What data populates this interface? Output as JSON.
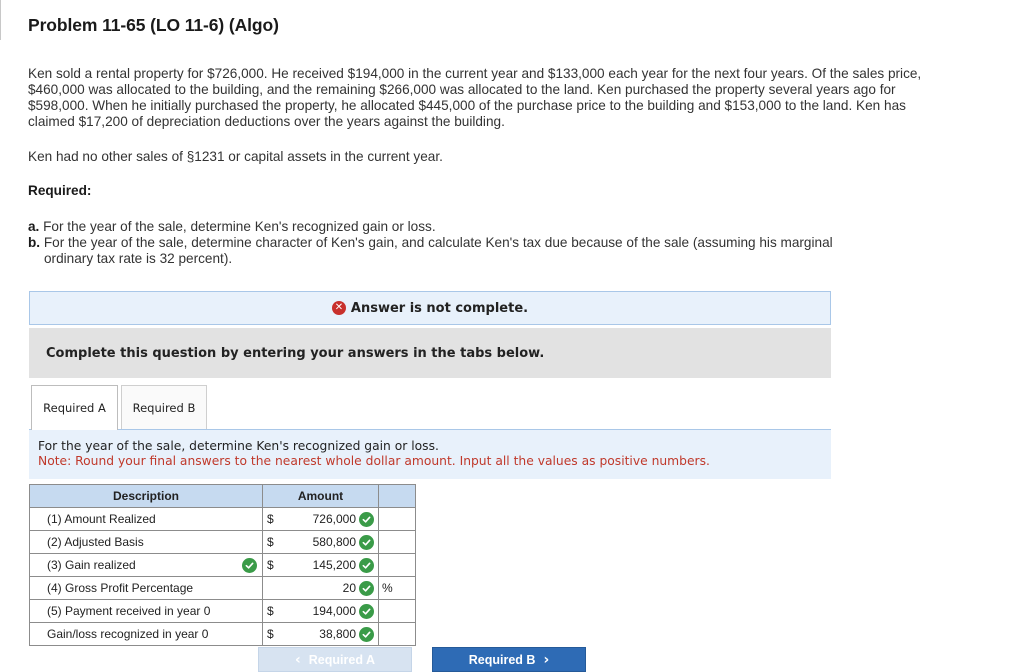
{
  "problem": {
    "title": "Problem 11-65 (LO 11-6) (Algo)",
    "paragraph1": "Ken sold a rental property for $726,000. He received $194,000 in the current year and $133,000 each year for the next four years. Of the sales price, $460,000 was allocated to the building, and the remaining $266,000 was allocated to the land. Ken purchased the property several years ago for $598,000. When he initially purchased the property, he allocated $445,000 of the purchase price to the building and $153,000 to the land. Ken has claimed $17,200 of depreciation deductions over the years against the building.",
    "paragraph2": "Ken had no other sales of §1231 or capital assets in the current year.",
    "required_label": "Required:",
    "item_a_label": "a.",
    "item_a_text": "For the year of the sale, determine Ken's recognized gain or loss.",
    "item_b_label": "b.",
    "item_b_text_line1": "For the year of the sale, determine character of Ken's gain, and calculate Ken's tax due because of the sale (assuming his marginal",
    "item_b_text_line2": "ordinary tax rate is 32 percent)."
  },
  "status": {
    "icon": "x-circle-icon",
    "text": "Answer is not complete."
  },
  "instruction": "Complete this question by entering your answers in the tabs below.",
  "tabs": [
    {
      "label": "Required A",
      "active": true
    },
    {
      "label": "Required B",
      "active": false
    }
  ],
  "prompt": {
    "text": "For the year of the sale, determine Ken's recognized gain or loss.",
    "note": "Note: Round your final answers to the nearest whole dollar amount. Input all the values as positive numbers."
  },
  "table": {
    "headers": [
      "Description",
      "Amount",
      ""
    ],
    "rows": [
      {
        "description": "(1) Amount Realized",
        "currency": "$",
        "value": "726,000",
        "unit": "",
        "desc_check": false
      },
      {
        "description": "(2) Adjusted Basis",
        "currency": "$",
        "value": "580,800",
        "unit": "",
        "desc_check": false
      },
      {
        "description": "(3) Gain realized",
        "currency": "$",
        "value": "145,200",
        "unit": "",
        "desc_check": true
      },
      {
        "description": "(4) Gross Profit Percentage",
        "currency": "",
        "value": "20",
        "unit": "%",
        "desc_check": false
      },
      {
        "description": "(5) Payment received in year 0",
        "currency": "$",
        "value": "194,000",
        "unit": "",
        "desc_check": false
      },
      {
        "description": "Gain/loss recognized in year 0",
        "currency": "$",
        "value": "38,800",
        "unit": "",
        "desc_check": false
      }
    ]
  },
  "nav": {
    "prev_label": "Required A",
    "next_label": "Required B"
  },
  "colors": {
    "check_green": "#3a9b48",
    "error_red": "#c8302c",
    "note_red": "#c0392b",
    "accent_blue": "#2e6bb5"
  }
}
